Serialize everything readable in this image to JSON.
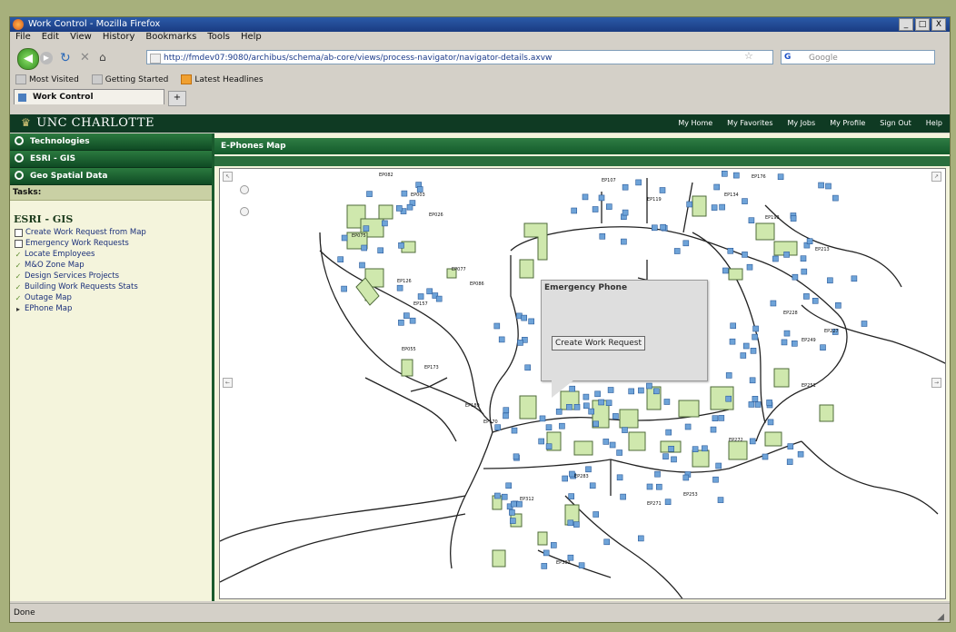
{
  "window": {
    "title": "Work Control - Mozilla Firefox",
    "buttons": [
      "_",
      "□",
      "X"
    ]
  },
  "menu": [
    "File",
    "Edit",
    "View",
    "History",
    "Bookmarks",
    "Tools",
    "Help"
  ],
  "navbar": {
    "url": "http://fmdev07:9080/archibus/schema/ab-core/views/process-navigator/navigator-details.axvw",
    "search_placeholder": "Google",
    "search_logo": "G"
  },
  "bookmarks": [
    "Most Visited",
    "Getting Started",
    "Latest Headlines"
  ],
  "tab": {
    "title": "Work Control",
    "new_tab": "+"
  },
  "site": {
    "logo": "UNC CHARLOTTE",
    "nav": [
      "My Home",
      "My Favorites",
      "My Jobs",
      "My Profile",
      "Sign Out",
      "Help"
    ]
  },
  "sidebar": {
    "accordions": [
      "Technologies",
      "ESRI - GIS",
      "Geo Spatial Data"
    ],
    "tasks_header": "Tasks:",
    "section_title": "ESRI - GIS",
    "tasks": [
      {
        "label": "Create Work Request from Map",
        "marker": "checkbox"
      },
      {
        "label": "Emergency Work Requests",
        "marker": "checkbox"
      },
      {
        "label": "Locate Employees",
        "marker": "tick"
      },
      {
        "label": "M&O Zone Map",
        "marker": "tick"
      },
      {
        "label": "Design Services Projects",
        "marker": "tick"
      },
      {
        "label": "Building Work Requests Stats",
        "marker": "tick"
      },
      {
        "label": "Outage Map",
        "marker": "tick"
      },
      {
        "label": "EPhone Map",
        "marker": "arrow"
      }
    ]
  },
  "main": {
    "panel_title": "E-Phones Map",
    "popup": {
      "title": "Emergency Phone",
      "button": "Create Work Request"
    },
    "map_labels": [
      "EP082",
      "EP003",
      "EP026",
      "EP075",
      "EP077",
      "EP086",
      "EP126",
      "EP157",
      "EP170",
      "EP173",
      "EP189",
      "EP055",
      "EP107",
      "EP119",
      "EP134",
      "EP176",
      "EP193",
      "EP213",
      "EP227",
      "EP228",
      "EP249",
      "EP251",
      "EP253",
      "EP271",
      "EP272",
      "EP283",
      "EP312",
      "EP303"
    ],
    "colors": {
      "building_fill": "#cfe8ad",
      "building_stroke": "#4f6b3a",
      "phone_icon": "#6ea3d8",
      "road": "#222222"
    }
  },
  "status": {
    "text": "Done"
  }
}
